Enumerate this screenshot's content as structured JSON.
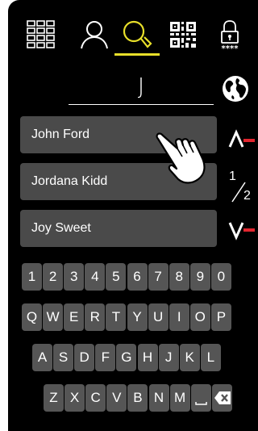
{
  "toolbar": {
    "items": [
      "keypad-grid-icon",
      "contacts-person-icon",
      "search-icon",
      "qr-code-icon",
      "lock-code-icon"
    ],
    "active": "search-icon",
    "lock_code": "****",
    "accent_color": "#e8df2a"
  },
  "search": {
    "value": "J"
  },
  "contacts": [
    {
      "name": "John Ford"
    },
    {
      "name": "Jordana Kidd"
    },
    {
      "name": "Joy Sweet"
    }
  ],
  "pagination": {
    "current": "1",
    "total": "2"
  },
  "keyboard": {
    "row1": [
      "1",
      "2",
      "3",
      "4",
      "5",
      "6",
      "7",
      "8",
      "9",
      "0"
    ],
    "row2": [
      "Q",
      "W",
      "E",
      "R",
      "T",
      "Y",
      "U",
      "I",
      "O",
      "P"
    ],
    "row3": [
      "A",
      "S",
      "D",
      "F",
      "G",
      "H",
      "J",
      "K",
      "L"
    ],
    "row4": [
      "Z",
      "X",
      "C",
      "V",
      "B",
      "N",
      "M"
    ],
    "space_icon": "space-icon",
    "backspace_icon": "backspace-icon"
  },
  "colors": {
    "background": "#000000",
    "button": "#4a4a4a",
    "arrow_accent": "#e3262f"
  }
}
